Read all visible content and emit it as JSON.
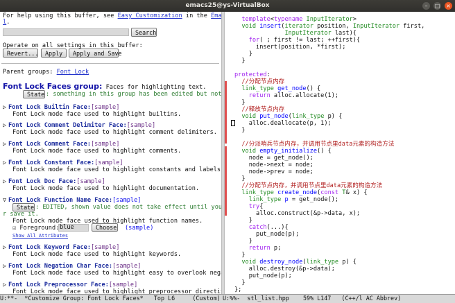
{
  "window": {
    "title": "emacs25@ys-VirtualBox"
  },
  "left": {
    "help_prefix": "For help using this buffer, see ",
    "help_link": "Easy Customization",
    "help_mid": " in the ",
    "help_link2": "Emacs manua",
    "help_wrap": "l",
    "help_end": ".",
    "search_value": "",
    "search_label": "Search",
    "operate_text": "Operate on all settings in this buffer:",
    "revert_label": "Revert...",
    "apply_label": "Apply",
    "apply_save_label": "Apply and Save",
    "parent_groups_label": "Parent groups: ",
    "parent_group_link": "Font Lock",
    "group_title": "Font Lock Faces group:",
    "group_desc": " Faces for highlighting text.",
    "state_label": "State",
    "group_state_text": ": something in this group has been edited but not set.",
    "faces": [
      {
        "name": "Font Lock Builtin Face:",
        "sample": "[sample]",
        "doc": "Font Lock mode face used to highlight builtins."
      },
      {
        "name": "Font Lock Comment Delimiter Face:",
        "sample": "[sample]",
        "doc": "Font Lock mode face used to highlight comment delimiters."
      },
      {
        "name": "Font Lock Comment Face:",
        "sample": "[sample]",
        "doc": "Font Lock mode face used to highlight comments."
      },
      {
        "name": "Font Lock Constant Face:",
        "sample": "[sample]",
        "doc": "Font Lock mode face used to highlight constants and labels."
      },
      {
        "name": "Font Lock Doc Face:",
        "sample": "[sample]",
        "doc": "Font Lock mode face used to highlight documentation."
      }
    ],
    "expanded_face": {
      "name": "Font Lock Function Name Face:",
      "sample": "[sample]",
      "state_label": "State",
      "state_text": ": EDITED, shown value does not take effect until you set o",
      "state_wrap": "r save it.",
      "doc": "Font Lock mode face used to highlight function names.",
      "fg_label": "Foreground: ",
      "fg_value": "blue",
      "choose_label": "Choose",
      "sample_paren": "(sample)",
      "show_all": "Show All Attributes"
    },
    "faces_after": [
      {
        "name": "Font Lock Keyword Face:",
        "sample": "[sample]",
        "doc": "Font Lock mode face used to highlight keywords."
      },
      {
        "name": "Font Lock Negation Char Face:",
        "sample": "[sample]",
        "doc": "Font Lock mode face used to highlight easy to overlook negation."
      },
      {
        "name": "Font Lock Preprocessor Face:",
        "sample": "[sample]",
        "doc": "Font Lock mode face used to highlight preprocessor directives."
      }
    ],
    "modeline": "U:**-  *Customize Group: Font Lock Faces*   Top L6     (Custom)"
  },
  "right": {
    "code_lines": [
      [
        {
          "t": "  "
        },
        {
          "t": "template",
          "c": "kw"
        },
        {
          "t": "<"
        },
        {
          "t": "typename",
          "c": "kw"
        },
        {
          "t": " "
        },
        {
          "t": "InputIterator",
          "c": "ty"
        },
        {
          "t": ">"
        }
      ],
      [
        {
          "t": "  "
        },
        {
          "t": "void",
          "c": "ty"
        },
        {
          "t": " "
        },
        {
          "t": "insert",
          "c": "fn"
        },
        {
          "t": "("
        },
        {
          "t": "iterator",
          "c": "ty"
        },
        {
          "t": " position, "
        },
        {
          "t": "InputIterator",
          "c": "ty"
        },
        {
          "t": " first,"
        }
      ],
      [
        {
          "t": "              "
        },
        {
          "t": "InputIterator",
          "c": "ty"
        },
        {
          "t": " last){"
        }
      ],
      [
        {
          "t": "    "
        },
        {
          "t": "for",
          "c": "kw"
        },
        {
          "t": "( ; first != last; ++first){"
        }
      ],
      [
        {
          "t": "      insert(position, *first);"
        }
      ],
      [
        {
          "t": "    }"
        }
      ],
      [
        {
          "t": "  }"
        }
      ],
      [
        {
          "t": ""
        }
      ],
      [
        {
          "t": "protected",
          "c": "kw"
        },
        {
          "t": ":"
        }
      ],
      [
        {
          "t": "  "
        },
        {
          "t": "//分配节点内存",
          "c": "cm"
        }
      ],
      [
        {
          "t": "  "
        },
        {
          "t": "link_type",
          "c": "ty"
        },
        {
          "t": " "
        },
        {
          "t": "get_node",
          "c": "fn"
        },
        {
          "t": "() {"
        }
      ],
      [
        {
          "t": "    "
        },
        {
          "t": "return",
          "c": "kw"
        },
        {
          "t": " alloc.allocate(1);"
        }
      ],
      [
        {
          "t": "  }"
        }
      ],
      [
        {
          "t": "  "
        },
        {
          "t": "//释放节点内存",
          "c": "cm"
        }
      ],
      [
        {
          "t": "  "
        },
        {
          "t": "void",
          "c": "ty"
        },
        {
          "t": " "
        },
        {
          "t": "put_node",
          "c": "fn"
        },
        {
          "t": "("
        },
        {
          "t": "link_type",
          "c": "ty"
        },
        {
          "t": " p) {"
        }
      ],
      [
        {
          "t": "    alloc.deallocate(p, 1);"
        }
      ],
      [
        {
          "t": "  }"
        }
      ],
      [
        {
          "t": ""
        }
      ],
      [
        {
          "t": "  "
        },
        {
          "t": "//分派哨兵节点内存，并调用节点里data元素的构造方法",
          "c": "cm"
        }
      ],
      [
        {
          "t": "  "
        },
        {
          "t": "void",
          "c": "ty"
        },
        {
          "t": " "
        },
        {
          "t": "empty_initialize",
          "c": "fn"
        },
        {
          "t": "() {"
        }
      ],
      [
        {
          "t": "    node = get_node();"
        }
      ],
      [
        {
          "t": "    node->next = node;"
        }
      ],
      [
        {
          "t": "    node->prev = node;"
        }
      ],
      [
        {
          "t": "  }"
        }
      ],
      [
        {
          "t": "  "
        },
        {
          "t": "//分配节点内存，并调用节点里data元素的构造方法",
          "c": "cm"
        }
      ],
      [
        {
          "t": "  "
        },
        {
          "t": "link_type",
          "c": "ty"
        },
        {
          "t": " "
        },
        {
          "t": "create_node",
          "c": "fn"
        },
        {
          "t": "("
        },
        {
          "t": "const",
          "c": "kw"
        },
        {
          "t": " "
        },
        {
          "t": "T",
          "c": "ty"
        },
        {
          "t": "& x) {"
        }
      ],
      [
        {
          "t": "    "
        },
        {
          "t": "link_type",
          "c": "ty"
        },
        {
          "t": " "
        },
        {
          "t": "p",
          "c": "fn"
        },
        {
          "t": " = get_node();"
        }
      ],
      [
        {
          "t": "    "
        },
        {
          "t": "try",
          "c": "kw"
        },
        {
          "t": "{"
        }
      ],
      [
        {
          "t": "      alloc.construct(&p->data, x);"
        }
      ],
      [
        {
          "t": "    }"
        }
      ],
      [
        {
          "t": "    "
        },
        {
          "t": "catch",
          "c": "kw"
        },
        {
          "t": "(...){"
        }
      ],
      [
        {
          "t": "      put_node(p);"
        }
      ],
      [
        {
          "t": "    }"
        }
      ],
      [
        {
          "t": "    "
        },
        {
          "t": "return",
          "c": "kw"
        },
        {
          "t": " p;"
        }
      ],
      [
        {
          "t": "  }"
        }
      ],
      [
        {
          "t": "  "
        },
        {
          "t": "void",
          "c": "ty"
        },
        {
          "t": " "
        },
        {
          "t": "destroy_node",
          "c": "fn"
        },
        {
          "t": "("
        },
        {
          "t": "link_type",
          "c": "ty"
        },
        {
          "t": " p) {"
        }
      ],
      [
        {
          "t": "    alloc.destroy(&p->data);"
        }
      ],
      [
        {
          "t": "    put_node(p);"
        }
      ],
      [
        {
          "t": "  }"
        }
      ],
      [
        {
          "t": "};"
        }
      ]
    ],
    "modeline": "U:%%-  stl_list.hpp    59% L147   (C++/l AC Abbrev)"
  }
}
